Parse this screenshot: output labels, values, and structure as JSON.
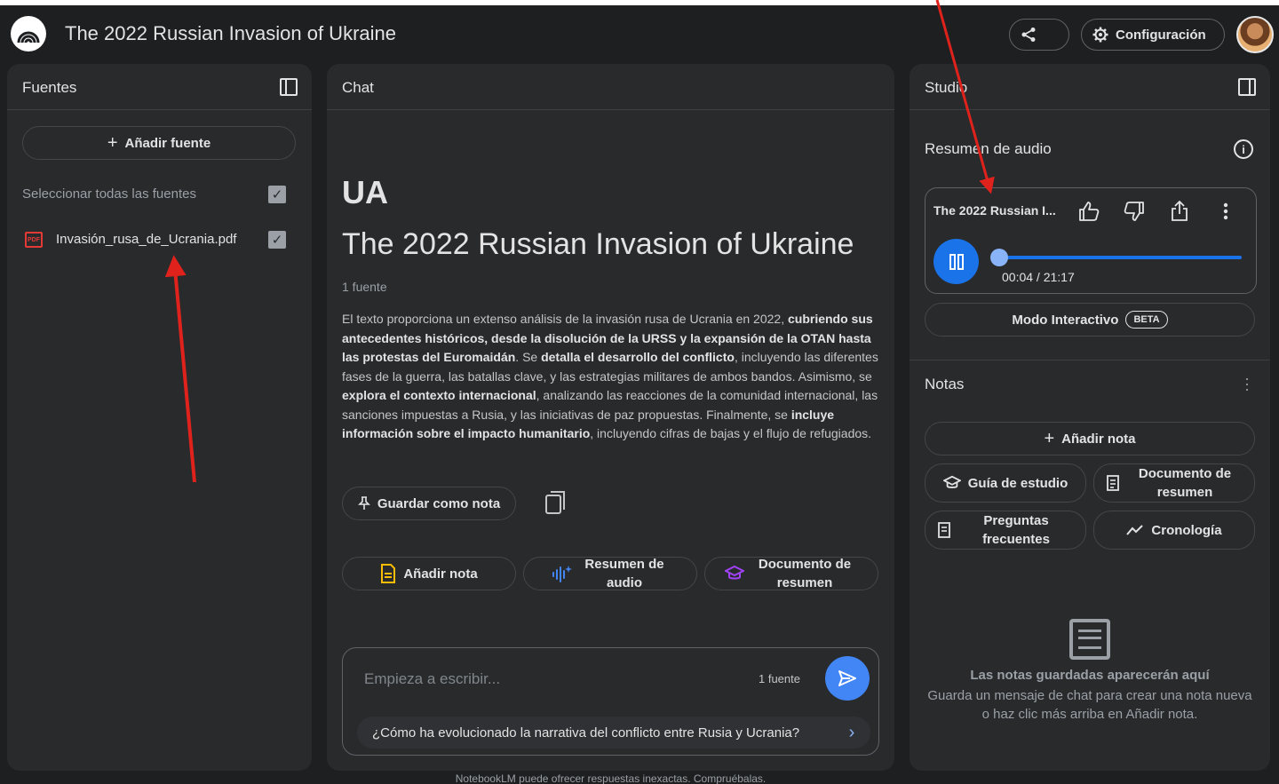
{
  "header": {
    "title": "The 2022 Russian Invasion of Ukraine",
    "config_label": "Configuración"
  },
  "sources": {
    "panel_title": "Fuentes",
    "add_label": "Añadir fuente",
    "select_all_label": "Seleccionar todas las fuentes",
    "items": [
      {
        "name": "Invasión_rusa_de_Ucrania.pdf",
        "checked": true,
        "icon": "pdf-icon"
      }
    ]
  },
  "chat": {
    "panel_title": "Chat",
    "emoji_title": "UA",
    "notebook_title": "The 2022 Russian Invasion of Ukraine",
    "source_count": "1 fuente",
    "summary_parts": [
      "El texto proporciona un extenso análisis de la invasión rusa de Ucrania en 2022, ",
      "cubriendo sus antecedentes históricos, desde la disolución de la URSS y la expansión de la OTAN hasta las protestas del Euromaidán",
      ". Se ",
      "detalla el desarrollo del conflicto",
      ", incluyendo las diferentes fases de la guerra, las batallas clave, y las estrategias militares de ambos bandos. Asimismo, se ",
      "explora el contexto internacional",
      ", analizando las reacciones de la comunidad internacional, las sanciones impuestas a Rusia, y las iniciativas de paz propuestas. Finalmente, se ",
      "incluye información sobre el impacto humanitario",
      ", incluyendo cifras de bajas y el flujo de refugiados."
    ],
    "save_note_label": "Guardar como nota",
    "actions": [
      {
        "label": "Añadir nota",
        "icon": "note-icon"
      },
      {
        "label": "Resumen de audio",
        "icon": "audio-wave-icon"
      },
      {
        "label": "Documento de resumen",
        "icon": "graduation-cap-icon"
      }
    ],
    "input_placeholder": "Empieza a escribir...",
    "input_source_count": "1 fuente",
    "suggestion": "¿Cómo ha evolucionado la narrativa del conflicto entre Rusia y Ucrania?",
    "footer": "NotebookLM puede ofrecer respuestas inexactas. Compruébalas."
  },
  "studio": {
    "panel_title": "Studio",
    "audio_title": "Resumen de audio",
    "player": {
      "name": "The 2022 Russian I...",
      "time": "00:04 / 21:17",
      "progress": 0.003
    },
    "interactive_label": "Modo Interactivo",
    "beta_label": "BETA",
    "notes_title": "Notas",
    "add_note_label": "Añadir nota",
    "note_buttons": [
      {
        "label": "Guía de estudio",
        "icon": "graduation-cap-icon"
      },
      {
        "label": "Documento de resumen",
        "icon": "doc-summary-icon"
      },
      {
        "label": "Preguntas frecuentes",
        "icon": "faq-icon"
      },
      {
        "label": "Cronología",
        "icon": "timeline-icon"
      }
    ],
    "empty_title": "Las notas guardadas aparecerán aquí",
    "empty_sub": "Guarda un mensaje de chat para crear una nota nueva o haz clic más arriba en Añadir nota."
  },
  "colors": {
    "background": "#1e1f20",
    "panel": "#282a2c",
    "accent": "#1a73e8",
    "annotation_arrow": "#e0221c"
  }
}
